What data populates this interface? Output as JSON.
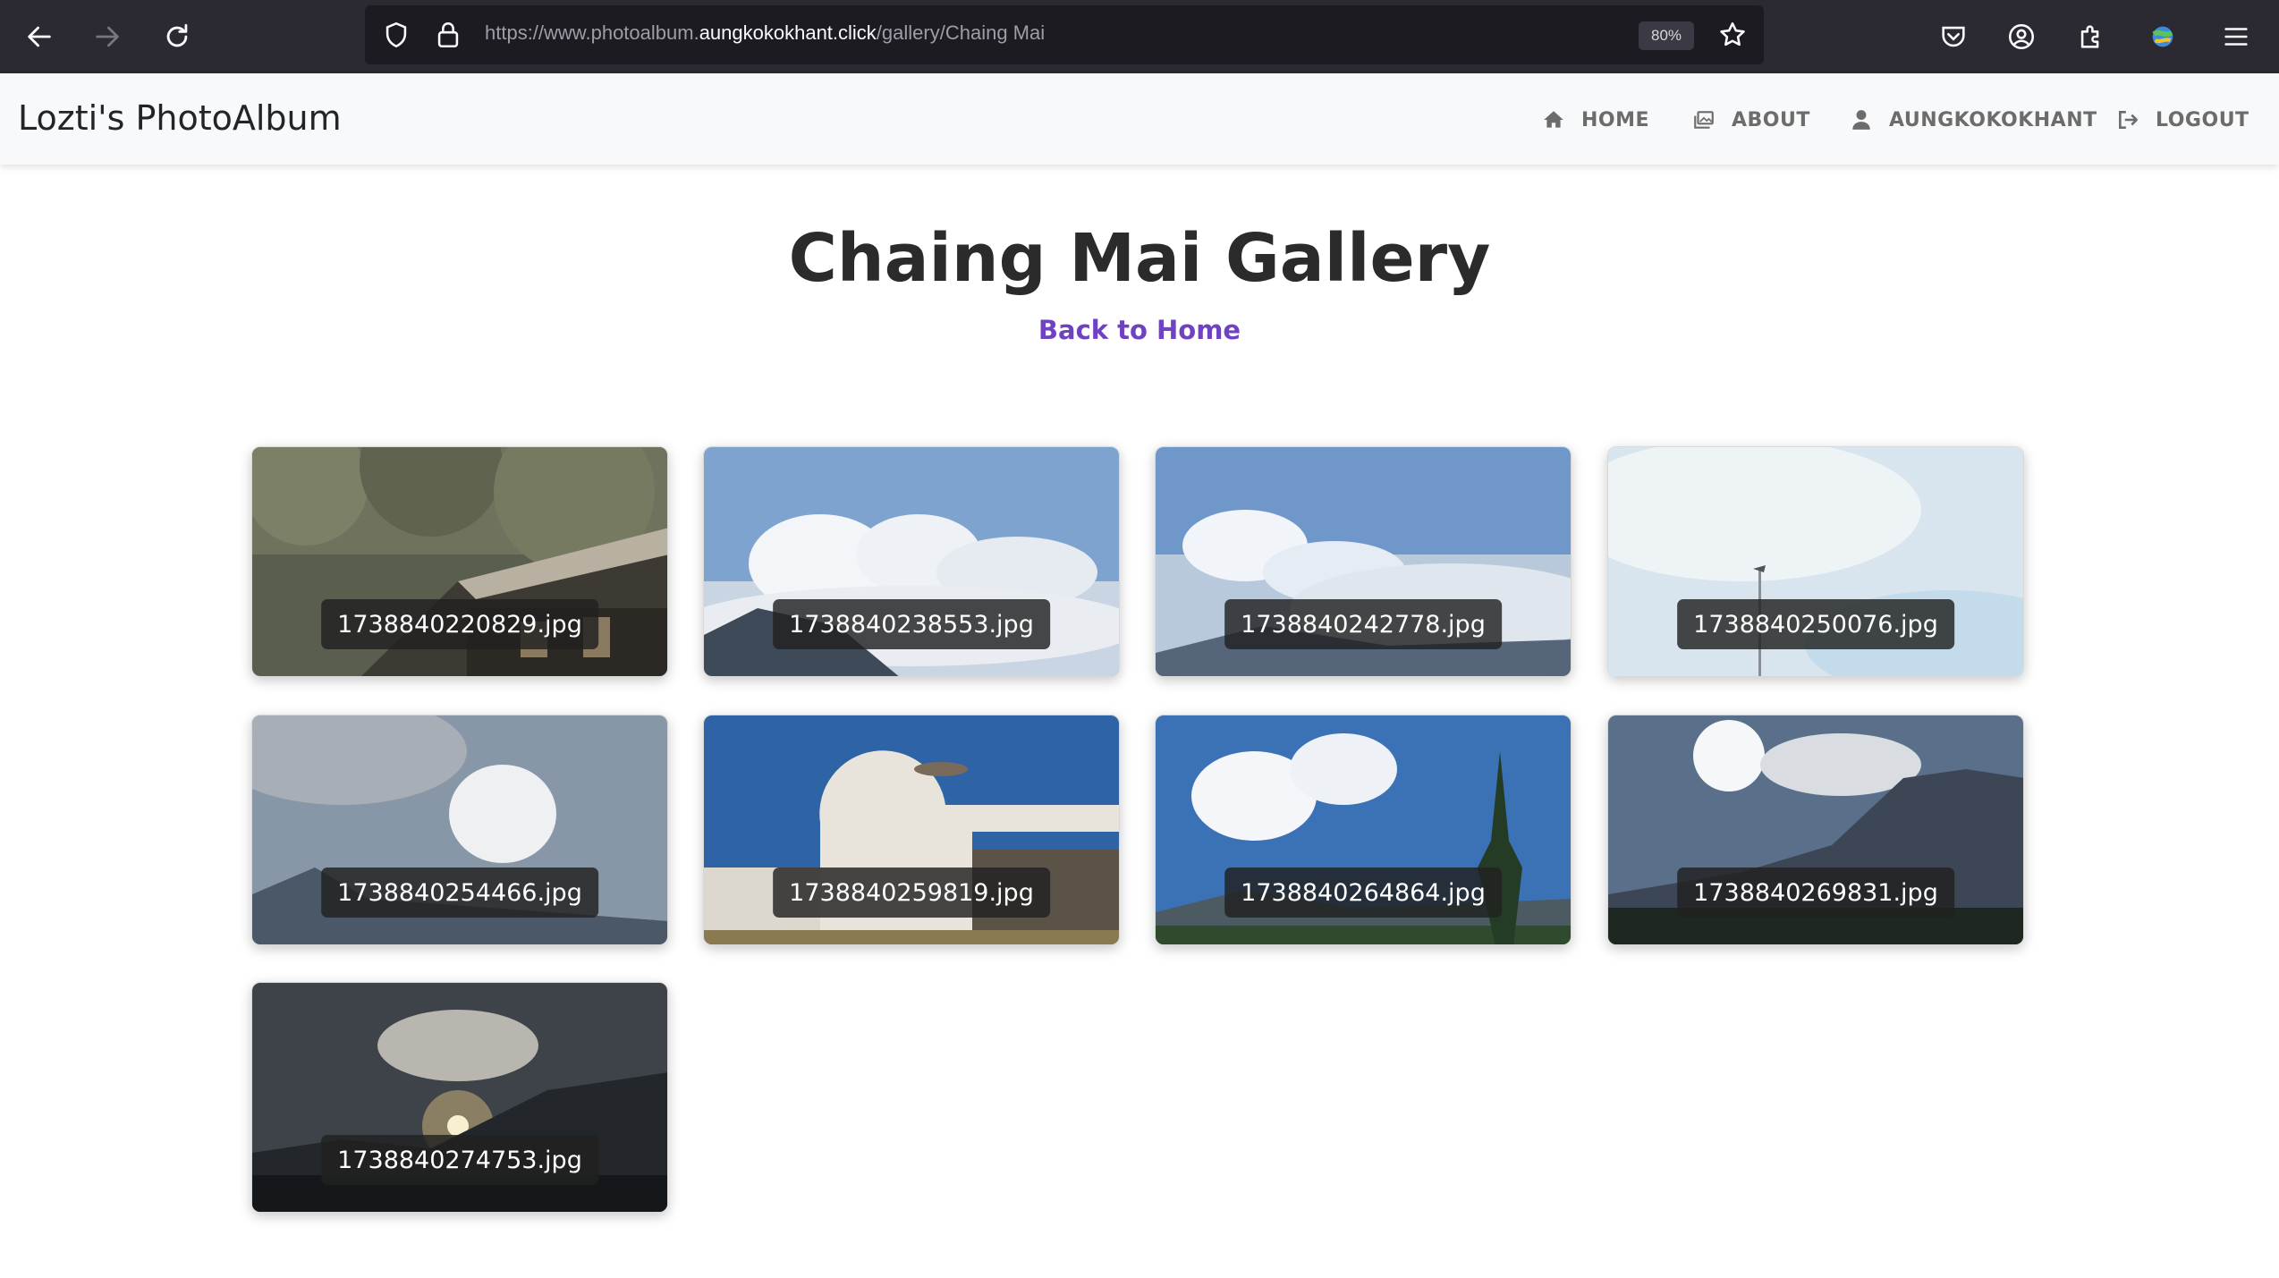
{
  "browser": {
    "url_prefix": "https://www.photoalbum.",
    "url_host": "aungkokokhant.click",
    "url_path": "/gallery/Chaing Mai",
    "zoom": "80%"
  },
  "navbar": {
    "brand": "Lozti's PhotoAlbum",
    "links": [
      {
        "label": "HOME",
        "icon": "home-icon"
      },
      {
        "label": "ABOUT",
        "icon": "images-icon"
      },
      {
        "label": "AUNGKOKOKHANT",
        "icon": "user-icon"
      },
      {
        "label": "LOGOUT",
        "icon": "sign-out-icon"
      }
    ]
  },
  "main": {
    "title": "Chaing Mai Gallery",
    "back_link": "Back to Home"
  },
  "gallery": [
    {
      "filename": "1738840220829.jpg",
      "scene": "forest-house"
    },
    {
      "filename": "1738840238553.jpg",
      "scene": "clouds-mountain"
    },
    {
      "filename": "1738840242778.jpg",
      "scene": "clouds-sea"
    },
    {
      "filename": "1738840250076.jpg",
      "scene": "pale-sky-pole"
    },
    {
      "filename": "1738840254466.jpg",
      "scene": "hazy-cloud"
    },
    {
      "filename": "1738840259819.jpg",
      "scene": "white-building"
    },
    {
      "filename": "1738840264864.jpg",
      "scene": "pine-clouds"
    },
    {
      "filename": "1738840269831.jpg",
      "scene": "sunburst-mountain"
    },
    {
      "filename": "1738840274753.jpg",
      "scene": "sunset"
    }
  ],
  "colors": {
    "chrome_bg": "#2b2a33",
    "navbar_bg": "#f8f9fa",
    "accent": "#6f42c1"
  }
}
